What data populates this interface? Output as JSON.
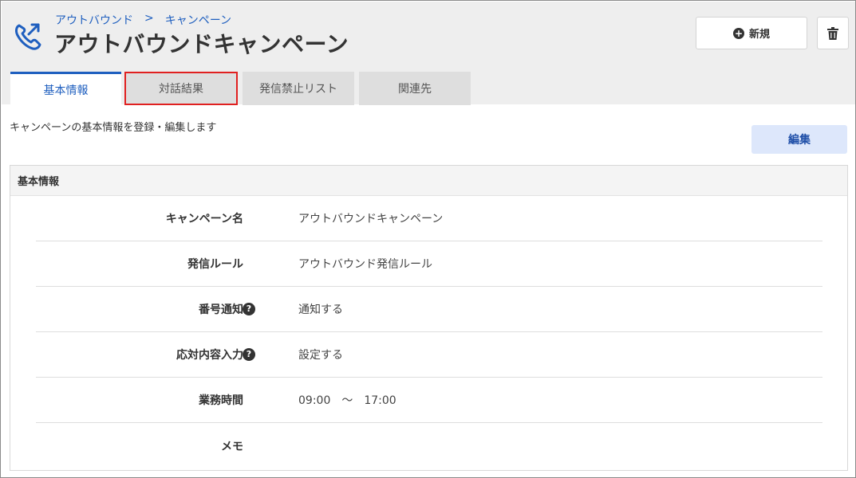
{
  "header": {
    "breadcrumb": [
      "アウトバウンド",
      ">",
      "キャンペーン"
    ],
    "title": "アウトバウンドキャンペーン",
    "new_label": "新規"
  },
  "tabs": [
    {
      "label": "基本情報",
      "active": true
    },
    {
      "label": "対話結果",
      "highlighted": true
    },
    {
      "label": "発信禁止リスト"
    },
    {
      "label": "関連先"
    }
  ],
  "description": "キャンペーンの基本情報を登録・編集します",
  "edit_label": "編集",
  "panel": {
    "title": "基本情報",
    "fields": [
      {
        "label": "キャンペーン名",
        "value": "アウトバウンドキャンペーン",
        "help": false
      },
      {
        "label": "発信ルール",
        "value": "アウトバウンド発信ルール",
        "help": false
      },
      {
        "label": "番号通知",
        "value": "通知する",
        "help": true
      },
      {
        "label": "応対内容入力",
        "value": "設定する",
        "help": true
      },
      {
        "label": "業務時間",
        "value": "09:00　～　17:00",
        "help": false
      },
      {
        "label": "メモ",
        "value": "",
        "help": false
      }
    ]
  },
  "icons": {
    "brand": "phone-outbound-icon",
    "new": "plus-circle-icon",
    "delete": "trash-icon",
    "help": "question-circle-icon"
  },
  "colors": {
    "accent": "#1f5fbf",
    "tab_highlight_border": "#e02020",
    "edit_button_bg": "#dde7fb"
  }
}
